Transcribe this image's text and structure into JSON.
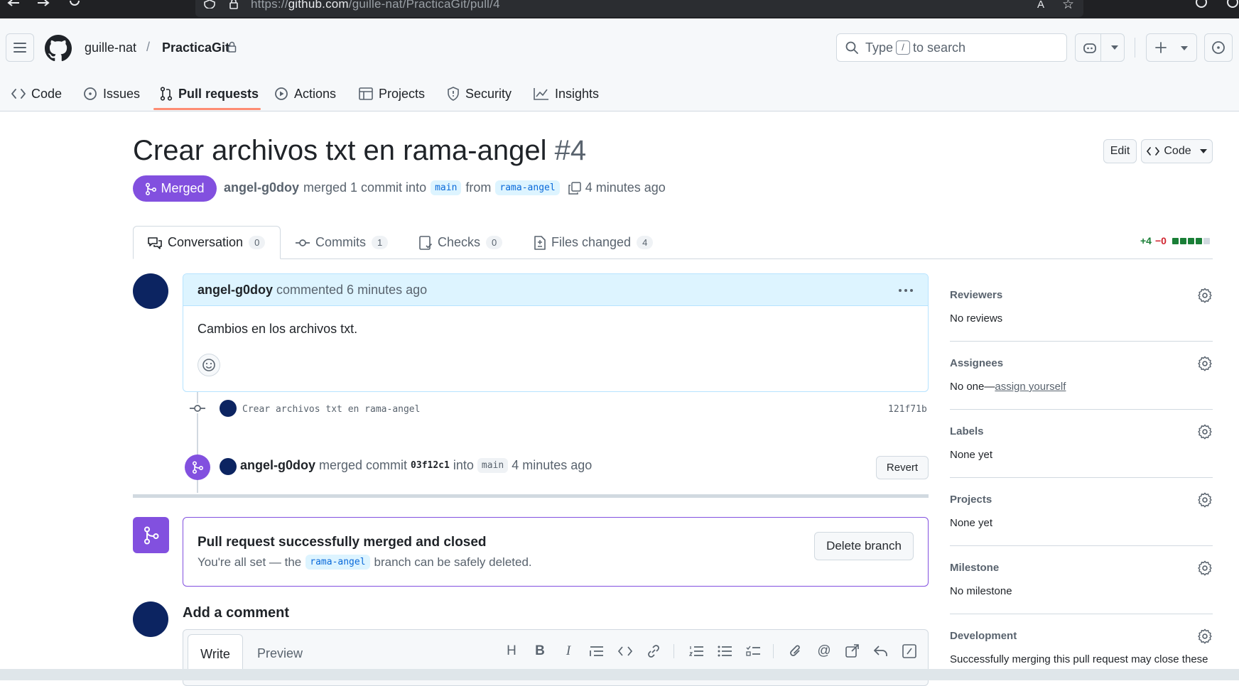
{
  "browser": {
    "url_prefix": "https://",
    "url_host": "github.com",
    "url_path": "/guille-nat/PracticaGit/pull/4"
  },
  "header": {
    "owner": "guille-nat",
    "repo": "PracticaGit",
    "search_before": "Type",
    "search_key": "/",
    "search_after": "to search"
  },
  "repo_tabs": [
    {
      "label": "Code",
      "icon": "code-icon"
    },
    {
      "label": "Issues",
      "icon": "issue-icon"
    },
    {
      "label": "Pull requests",
      "icon": "pull-request-icon"
    },
    {
      "label": "Actions",
      "icon": "play-icon"
    },
    {
      "label": "Projects",
      "icon": "table-icon"
    },
    {
      "label": "Security",
      "icon": "shield-icon"
    },
    {
      "label": "Insights",
      "icon": "graph-icon"
    }
  ],
  "pr": {
    "title": "Crear archivos txt en rama-angel",
    "number": "#4",
    "edit_label": "Edit",
    "code_label": "Code",
    "state": "Merged",
    "author": "angel-g0doy",
    "merged_text": "merged 1 commit into",
    "base_branch": "main",
    "from_text": "from",
    "head_branch": "rama-angel",
    "time": "4 minutes ago"
  },
  "pr_tabs": [
    {
      "label": "Conversation",
      "count": "0"
    },
    {
      "label": "Commits",
      "count": "1"
    },
    {
      "label": "Checks",
      "count": "0"
    },
    {
      "label": "Files changed",
      "count": "4"
    }
  ],
  "diffstat": {
    "added": "+4",
    "removed": "−0",
    "blocks_added": 4,
    "blocks_total": 5
  },
  "comment": {
    "author": "angel-g0doy",
    "action": "commented 6 minutes ago",
    "body": "Cambios en los archivos txt."
  },
  "commit_event": {
    "message": "Crear archivos txt en rama-angel",
    "sha": "121f71b"
  },
  "merge_event": {
    "author": "angel-g0doy",
    "text_1": "merged commit",
    "sha": "03f12c1",
    "text_2": "into",
    "branch": "main",
    "time": "4 minutes ago",
    "revert_label": "Revert"
  },
  "merge_box": {
    "title": "Pull request successfully merged and closed",
    "text_before": "You're all set — the",
    "branch": "rama-angel",
    "text_after": "branch can be safely deleted.",
    "delete_label": "Delete branch"
  },
  "add_comment": {
    "title": "Add a comment",
    "write_tab": "Write",
    "preview_tab": "Preview"
  },
  "sidebar": [
    {
      "title": "Reviewers",
      "value": "No reviews"
    },
    {
      "title": "Assignees",
      "value": "No one—",
      "link": "assign yourself"
    },
    {
      "title": "Labels",
      "value": "None yet"
    },
    {
      "title": "Projects",
      "value": "None yet"
    },
    {
      "title": "Milestone",
      "value": "No milestone"
    },
    {
      "title": "Development",
      "value": "Successfully merging this pull request may close these"
    }
  ],
  "colors": {
    "merged_purple": "#8250df",
    "link_blue": "#0969da",
    "added_green": "#1a7f37",
    "removed_red": "#d1242f",
    "tab_underline": "#fd8c73"
  }
}
